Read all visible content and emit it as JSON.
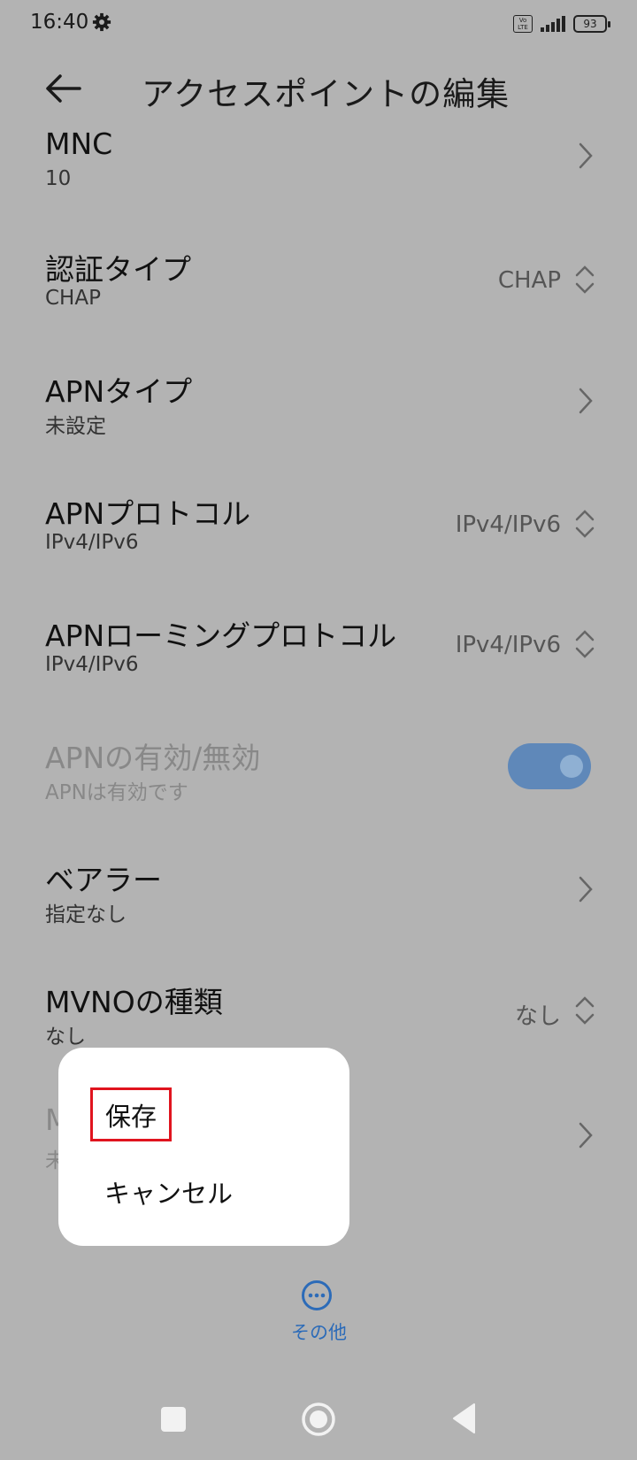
{
  "status_bar": {
    "time": "16:40",
    "settings_icon": "gear-icon",
    "volte_label": "Vo LTE",
    "battery_level": "93"
  },
  "header": {
    "title": "アクセスポイントの編集",
    "back_icon": "arrow-left-icon"
  },
  "rows": [
    {
      "id": "mnc",
      "title": "MNC",
      "subtitle": "10",
      "control": "chevron"
    },
    {
      "id": "auth-type",
      "title": "認証タイプ",
      "subtitle": "CHAP",
      "value": "CHAP",
      "control": "updown"
    },
    {
      "id": "apn-type",
      "title": "APNタイプ",
      "subtitle": "未設定",
      "control": "chevron"
    },
    {
      "id": "apn-protocol",
      "title": "APNプロトコル",
      "subtitle": "IPv4/IPv6",
      "value": "IPv4/IPv6",
      "control": "updown"
    },
    {
      "id": "apn-roaming-protocol",
      "title": "APNローミングプロトコル",
      "subtitle": "IPv4/IPv6",
      "value": "IPv4/IPv6",
      "control": "updown"
    },
    {
      "id": "apn-enable",
      "title": "APNの有効/無効",
      "subtitle": "APNは有効です",
      "control": "toggle",
      "toggle_on": true,
      "disabled": true
    },
    {
      "id": "bearer",
      "title": "ベアラー",
      "subtitle": "指定なし",
      "control": "chevron"
    },
    {
      "id": "mvno-type",
      "title": "MVNOの種類",
      "subtitle": "なし",
      "value": "なし",
      "control": "updown"
    },
    {
      "id": "mvno-value",
      "title": "M",
      "subtitle": "未",
      "control": "chevron",
      "partially_hidden": true
    }
  ],
  "popup_menu": {
    "items": [
      "保存",
      "キャンセル"
    ],
    "highlighted": "保存"
  },
  "more_button": {
    "label": "その他",
    "icon": "more-dots-icon"
  },
  "colors": {
    "background_dim": "#b3b3b3",
    "accent": "#2c6bb8",
    "highlight_box": "#e0141e",
    "toggle_on": "#5f88b9"
  }
}
